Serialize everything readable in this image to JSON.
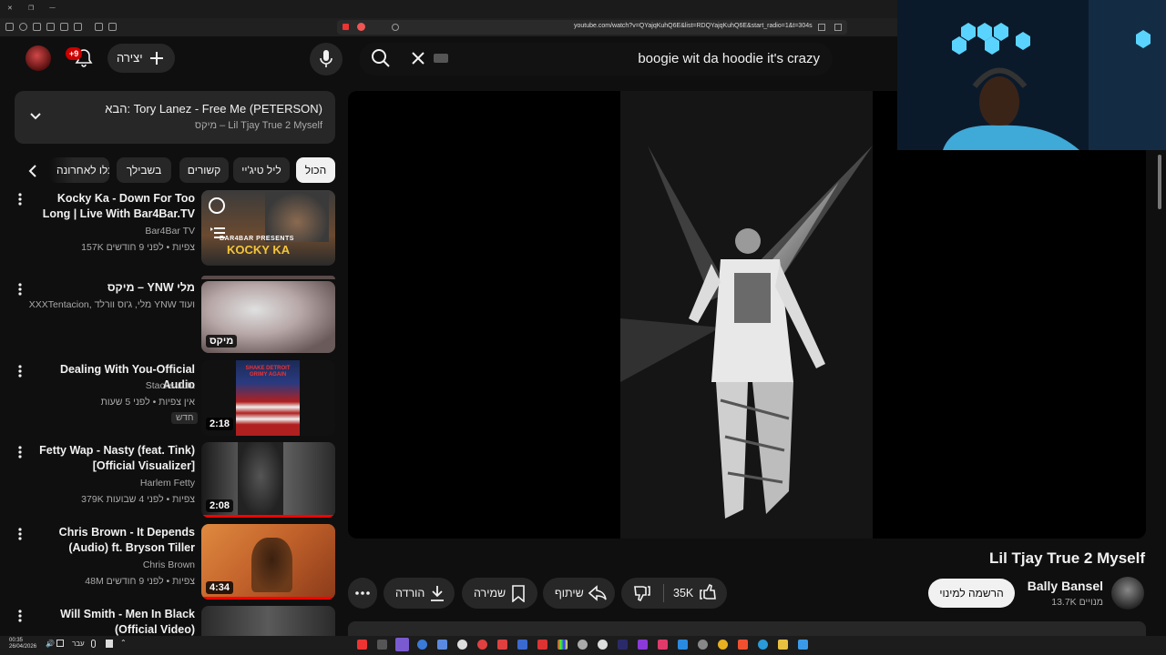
{
  "browser": {
    "url": "youtube.com/watch?v=QYajqKuhQ6E&list=RDQYajqKuhQ6E&start_radio=1&t=304s"
  },
  "header": {
    "search_value": "boogie wit da hoodie it's crazy",
    "create_label": "יצירה",
    "notification_badge": "+9"
  },
  "up_next": {
    "title": "הבא: Tory Lanez - Free Me (PETERSON)",
    "subtitle": "מיקס – Lil Tjay True 2 Myself"
  },
  "chips": [
    "הכול",
    "ליל טיג'יי",
    "קשורים",
    "בשבילך",
    "הועלו לאחרונה"
  ],
  "videos": [
    {
      "title": "Kocky Ka - Down For Too Long | Live With Bar4Bar.TV",
      "channel": "Bar4Bar TV",
      "stats": "157K צפיות • לפני 9 חודשים",
      "thumb_text": "KOCKY KA",
      "thumb_top_text": "BAR4BAR PRESENTS"
    },
    {
      "title": "מיקס – YNW מלי",
      "channel": "XXXTentacion, מלי, ג'וס וורלד YNW ועוד",
      "stats": "",
      "duration": "מיקס"
    },
    {
      "title": "Dealing With You-Official Audio",
      "channel": "Stacks JLIL",
      "stats": "אין צפיות • לפני 5 שעות",
      "badge": "חדש",
      "duration": "2:18",
      "thumb_text": "SHAKE DETROIT GRIMY AGAIN"
    },
    {
      "title": "Fetty Wap - Nasty (feat. Tink) [Official Visualizer]",
      "channel": "Harlem Fetty",
      "stats": "379K צפיות • לפני 4 שבועות",
      "duration": "2:08"
    },
    {
      "title": "Chris Brown - It Depends (Audio) ft. Bryson Tiller",
      "channel": "Chris Brown",
      "stats": "48M צפיות • לפני 9 חודשים",
      "duration": "4:34"
    },
    {
      "title": "Will Smith - Men In Black (Official Video)",
      "channel": "",
      "stats": ""
    }
  ],
  "player": {
    "title": "Lil Tjay True 2 Myself",
    "channel": "Bally Bansel",
    "subscribers": "13.7K מנויים",
    "subscribe_label": "הרשמה למינוי",
    "likes": "35K",
    "share_label": "שיתוף",
    "save_label": "שמירה",
    "download_label": "הורדה"
  },
  "taskbar": {
    "time": "00:35",
    "date": "26/04/2026",
    "lang": "עבר"
  },
  "colors": {
    "background": "#0f0f0f",
    "surface": "#272727",
    "accent_red": "#ff0000",
    "text": "#f1f1f1",
    "muted": "#aaaaaa"
  }
}
